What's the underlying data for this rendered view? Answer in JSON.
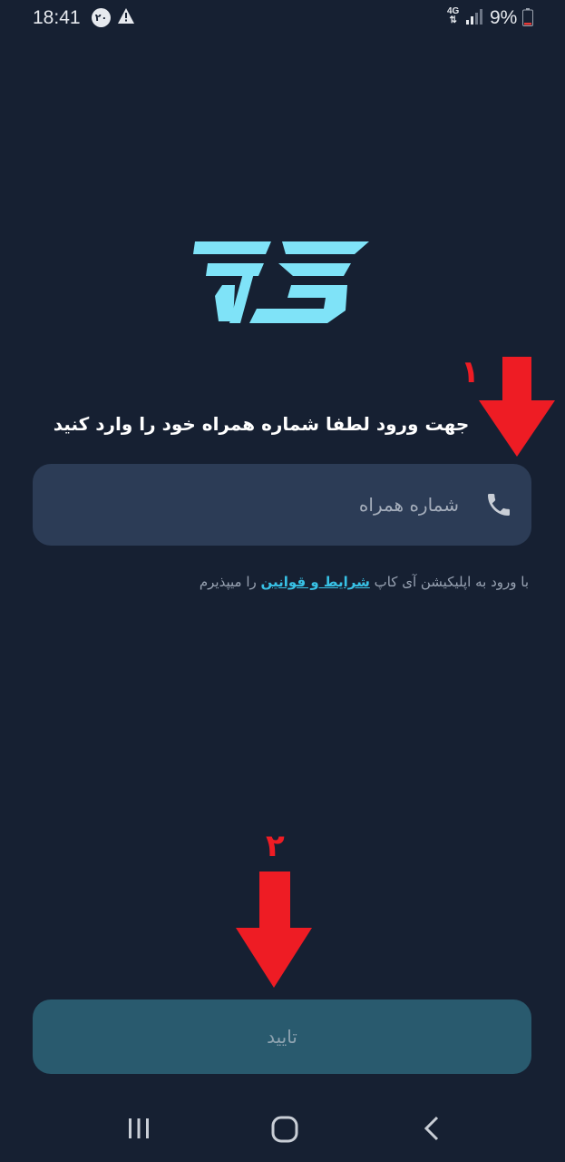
{
  "status_bar": {
    "time": "18:41",
    "notification_count": "۲۰",
    "network": "4G",
    "battery": "9%"
  },
  "icons": {
    "phone": "phone-icon",
    "warning": "warning-icon",
    "recents": "recents-icon",
    "home": "home-icon",
    "back": "back-icon"
  },
  "login": {
    "instruction": "جهت ورود لطفا شماره همراه خود را وارد کنید",
    "phone_placeholder": "شماره همراه",
    "phone_value": "",
    "terms_before": "با ورود به اپلیکیشن آی کاپ ",
    "terms_link": "شرایط و قوانین",
    "terms_after": " را میپذیرم",
    "confirm_label": "تایید"
  },
  "annotations": {
    "step1": "۱",
    "step2": "۲"
  },
  "colors": {
    "background": "#162032",
    "input_background": "#2c3c56",
    "button_background": "#295a6e",
    "link": "#38c1e5",
    "logo": "#7fe3f8",
    "annotation": "#ee1c24"
  }
}
